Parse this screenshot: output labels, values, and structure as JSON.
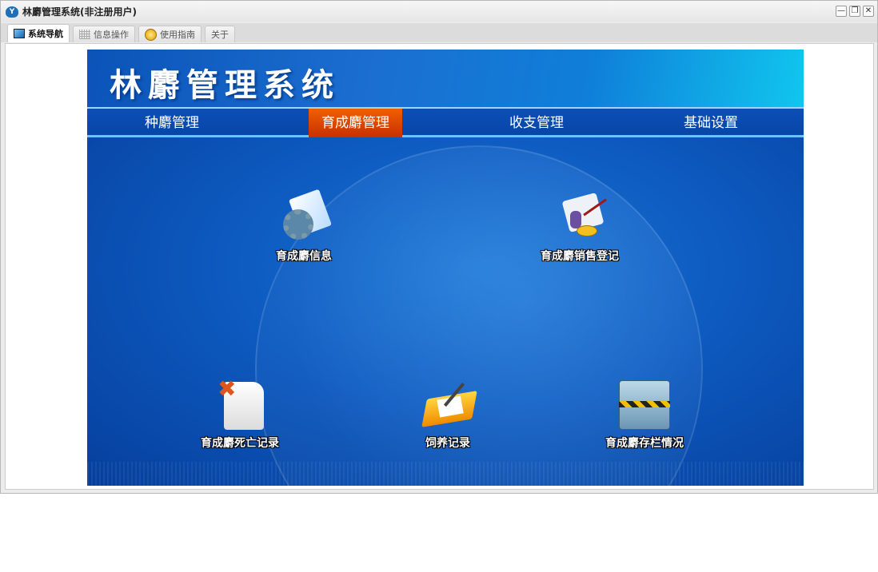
{
  "window": {
    "title": "林麝管理系统(非注册用户)",
    "app_icon": "Y"
  },
  "window_buttons": {
    "minimize": "—",
    "restore": "❐",
    "close": "✕"
  },
  "tabs": [
    {
      "label": "系统导航",
      "icon": "monitor-icon"
    },
    {
      "label": "信息操作",
      "icon": "grid-icon"
    },
    {
      "label": "使用指南",
      "icon": "help-icon"
    },
    {
      "label": "关于"
    }
  ],
  "banner": {
    "title": "林麝管理系统"
  },
  "nav": [
    {
      "label": "种麝管理"
    },
    {
      "label": "育成麝管理",
      "active": true
    },
    {
      "label": "收支管理"
    },
    {
      "label": "基础设置"
    }
  ],
  "items": [
    {
      "label": "育成麝信息",
      "icon": "gear-document-icon"
    },
    {
      "label": "育成麝销售登记",
      "icon": "sales-register-icon"
    },
    {
      "label": "育成麝死亡记录",
      "icon": "delete-record-icon"
    },
    {
      "label": "饲养记录",
      "icon": "folder-pen-icon"
    },
    {
      "label": "育成麝存栏情况",
      "icon": "folder-icon"
    }
  ]
}
